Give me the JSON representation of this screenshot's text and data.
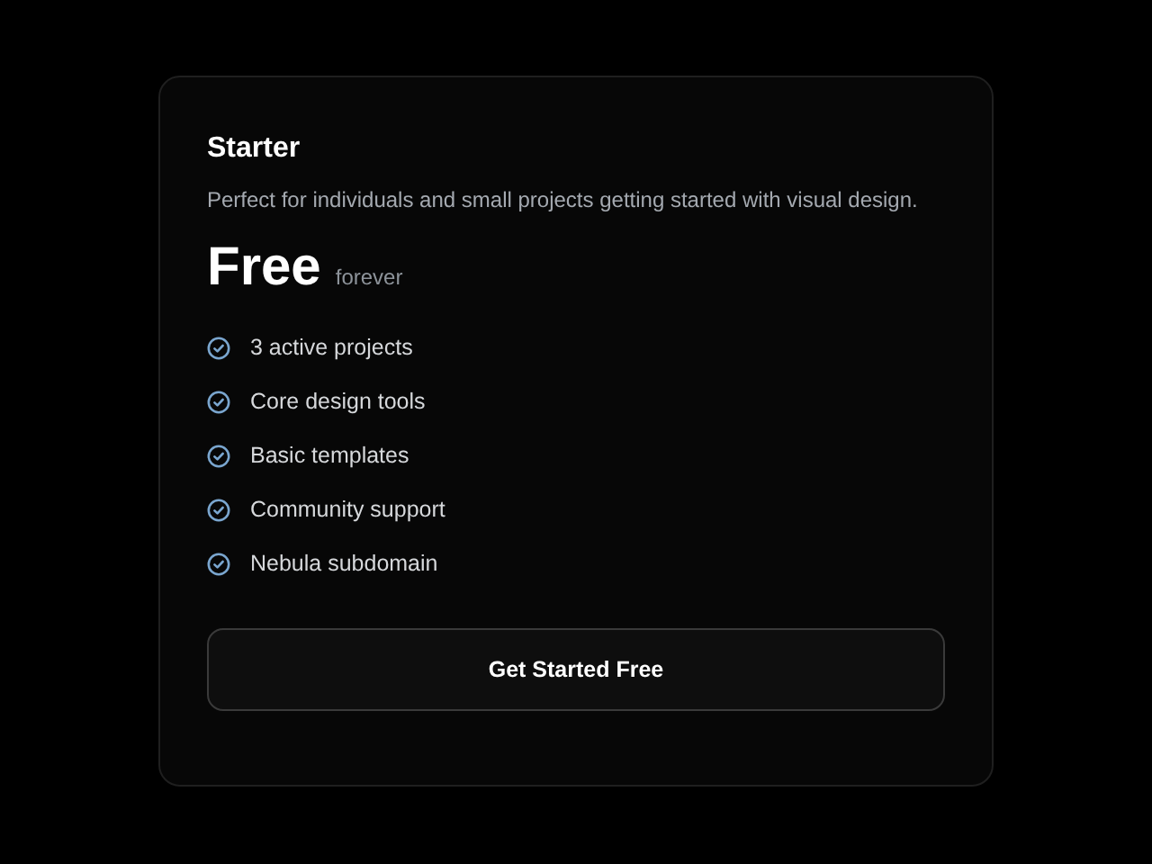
{
  "plan": {
    "name": "Starter",
    "description": "Perfect for individuals and small projects getting started with visual design.",
    "price": "Free",
    "period": "forever",
    "features": [
      {
        "label": "3 active projects"
      },
      {
        "label": "Core design tools"
      },
      {
        "label": "Basic templates"
      },
      {
        "label": "Community support"
      },
      {
        "label": "Nebula subdomain"
      }
    ],
    "button": "Get Started Free"
  }
}
